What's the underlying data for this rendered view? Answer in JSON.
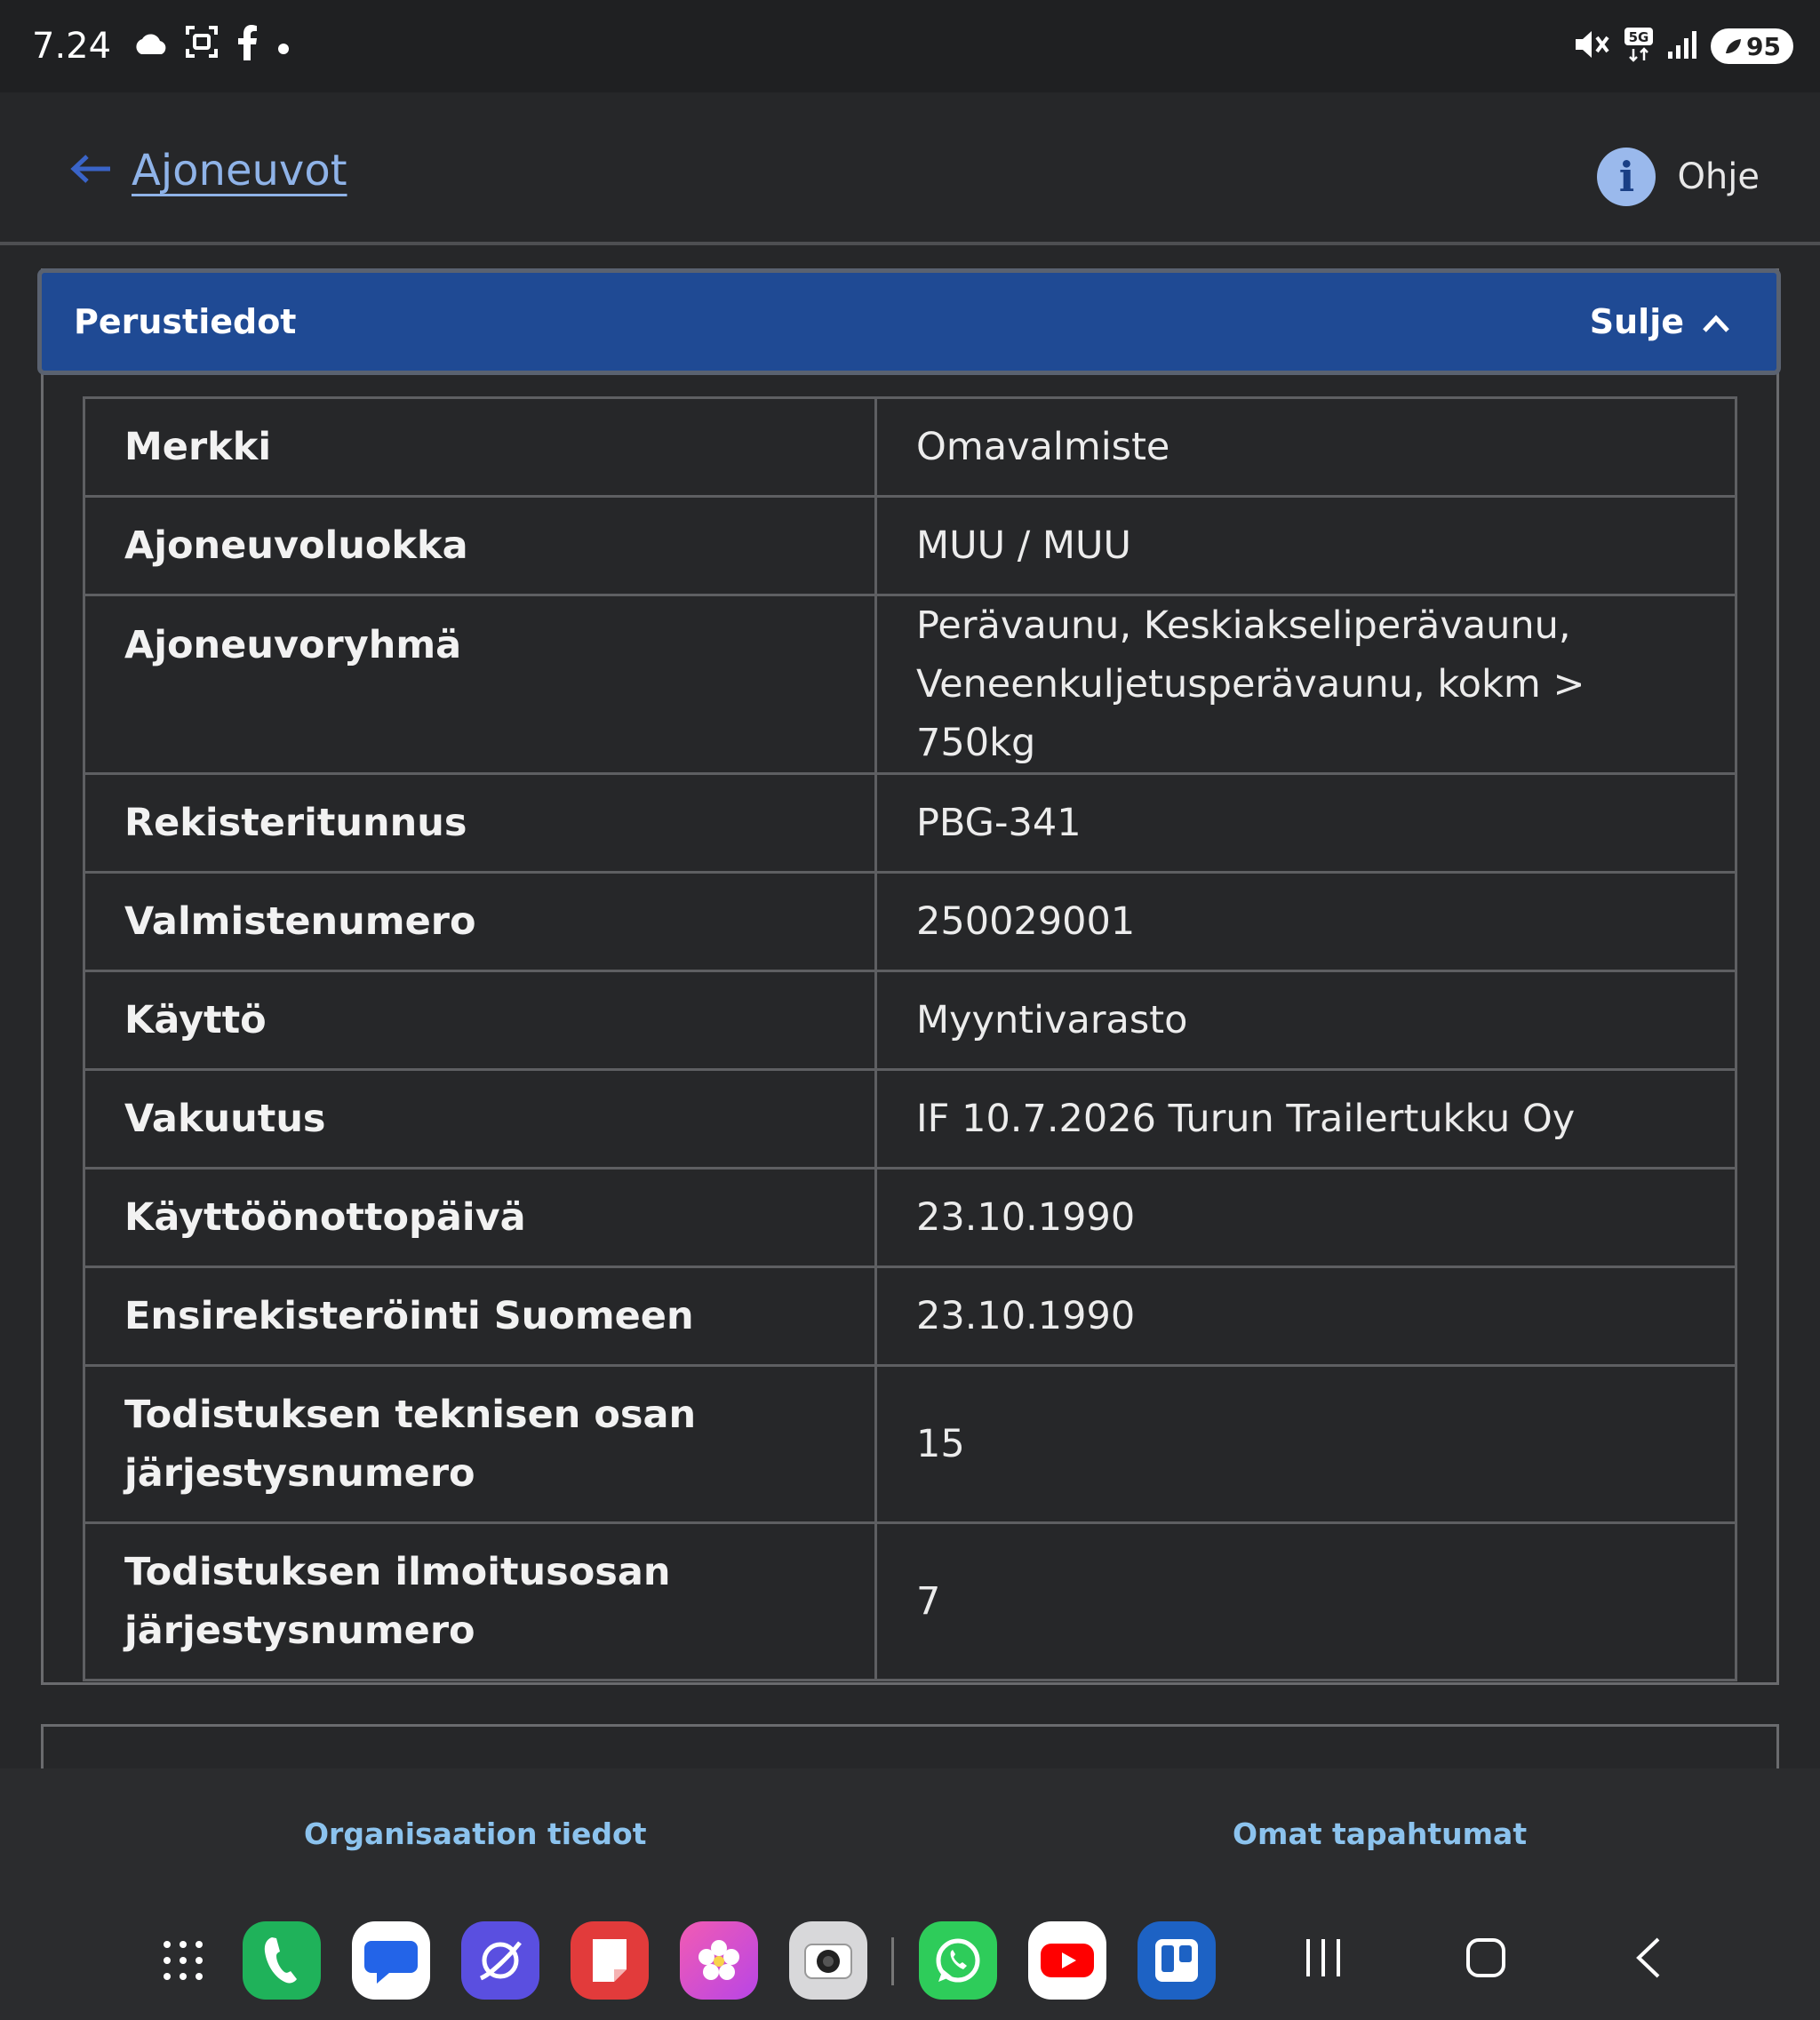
{
  "status_bar": {
    "time": "7.24",
    "left_icons": [
      "cloud-icon",
      "screenshot-icon",
      "facebook-icon",
      "dot-icon"
    ],
    "right_icons": [
      "mute-icon",
      "5g-icon",
      "signal-icon",
      "battery-icon"
    ],
    "battery_level": "95"
  },
  "header": {
    "back_label": "Ajoneuvot",
    "help_icon_glyph": "i",
    "help_label": "Ohje"
  },
  "panel": {
    "title": "Perustiedot",
    "toggle_label": "Sulje",
    "header_color": "#1f4a94",
    "rows": [
      {
        "label": "Merkki",
        "value": "Omavalmiste"
      },
      {
        "label": "Ajoneuvoluokka",
        "value": "MUU / MUU"
      },
      {
        "label": "Ajoneuvoryhmä",
        "value": "Perävaunu, Keskiakseliperävaunu, Veneenkuljetusperävaunu, kokm > 750kg"
      },
      {
        "label": "Rekisteritunnus",
        "value": "PBG-341"
      },
      {
        "label": "Valmistenumero",
        "value": "250029001"
      },
      {
        "label": "Käyttö",
        "value": "Myyntivarasto"
      },
      {
        "label": "Vakuutus",
        "value": "IF 10.7.2026 Turun Trailertukku Oy"
      },
      {
        "label": "Käyttöönottopäivä",
        "value": "23.10.1990"
      },
      {
        "label": "Ensirekisteröinti Suomeen",
        "value": "23.10.1990"
      },
      {
        "label": "Todistuksen teknisen osan järjestysnumero",
        "value": "15"
      },
      {
        "label": "Todistuksen ilmoitusosan järjestysnumero",
        "value": "7"
      }
    ]
  },
  "bottom_tabs": {
    "left": "Organisaation tiedot",
    "right": "Omat tapahtumat",
    "link_color": "#8cc3ee"
  },
  "dock": {
    "apps": [
      "app-drawer-icon",
      "phone-icon",
      "messages-icon",
      "internet-icon",
      "notes-icon",
      "gallery-icon",
      "camera-icon",
      "whatsapp-icon",
      "youtube-icon",
      "trello-icon"
    ],
    "nav": [
      "recents-icon",
      "home-icon",
      "back-icon"
    ]
  }
}
